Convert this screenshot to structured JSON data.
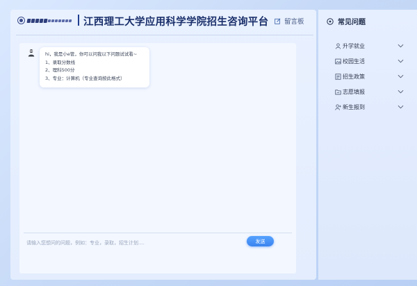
{
  "header": {
    "title": "江西理工大学应用科学学院招生咨询平台",
    "message_board_label": "留言板"
  },
  "chat": {
    "messages": [
      {
        "lines": [
          "hi，我是小e管，你可以问我以下问题试试看~",
          "1、录取分数线",
          "2、理科500分",
          "3、专业：计算机（专业查询按此格式）"
        ]
      }
    ],
    "input_placeholder": "请输入您想问的问题，例如：专业，录取，招生计划....",
    "send_label": "发送"
  },
  "faq": {
    "title": "常见问题",
    "items": [
      {
        "label": "升学就业",
        "icon": "person-icon"
      },
      {
        "label": "校园生活",
        "icon": "image-icon"
      },
      {
        "label": "招生政策",
        "icon": "document-icon"
      },
      {
        "label": "志愿填报",
        "icon": "folder-icon"
      },
      {
        "label": "新生报到",
        "icon": "user-add-icon"
      }
    ]
  },
  "colors": {
    "accent": "#3a84f0",
    "title": "#1a2f6a",
    "background": "#cfe0fb"
  }
}
